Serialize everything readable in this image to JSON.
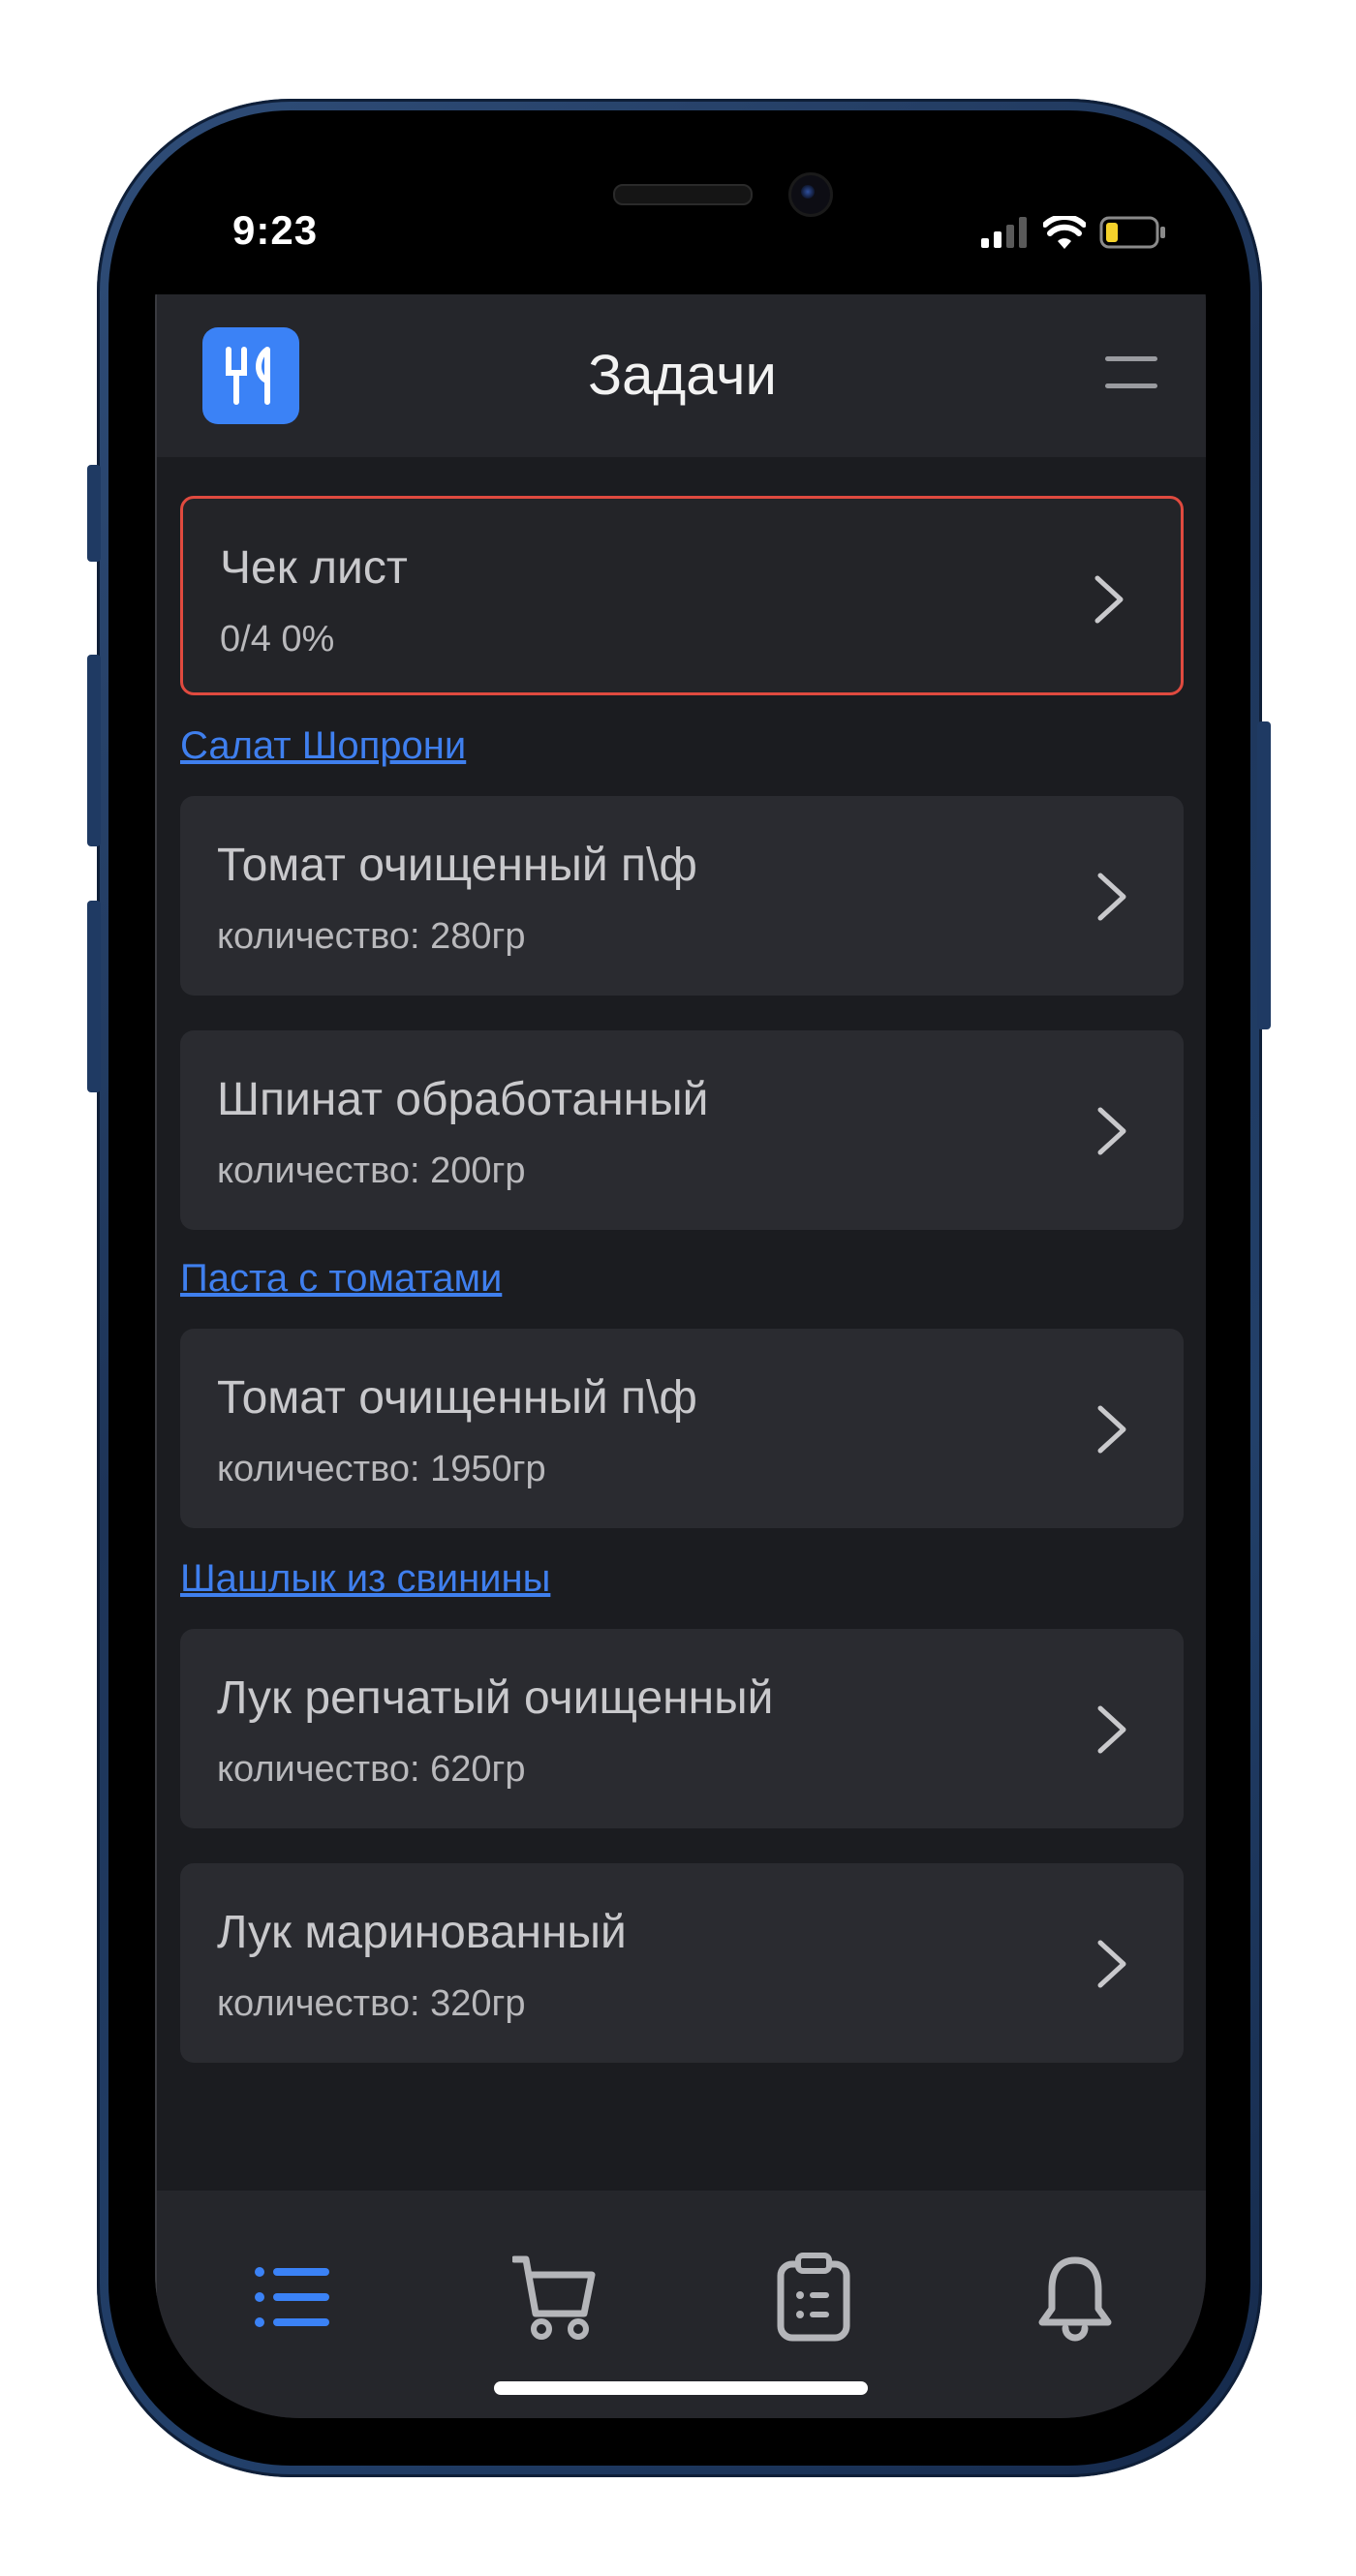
{
  "status_bar": {
    "time": "9:23"
  },
  "header": {
    "title": "Задачи"
  },
  "checklist": {
    "title": "Чек лист",
    "progress": "0/4 0%"
  },
  "sections": [
    {
      "title": "Салат Шопрони",
      "items": [
        {
          "name": "Томат очищенный п\\ф",
          "quantity": "количество: 280гр"
        },
        {
          "name": "Шпинат обработанный",
          "quantity": "количество: 200гр"
        }
      ]
    },
    {
      "title": "Паста с томатами",
      "items": [
        {
          "name": "Томат очищенный п\\ф",
          "quantity": "количество: 1950гр"
        }
      ]
    },
    {
      "title": "Шашлык из свинины",
      "items": [
        {
          "name": "Лук репчатый очищенный",
          "quantity": "количество: 620гр"
        },
        {
          "name": "Лук маринованный",
          "quantity": "количество: 320гр"
        }
      ]
    }
  ],
  "tabbar": {
    "tabs": [
      {
        "icon": "list-icon",
        "active": true
      },
      {
        "icon": "cart-icon",
        "active": false
      },
      {
        "icon": "clipboard-icon",
        "active": false
      },
      {
        "icon": "bell-icon",
        "active": false
      }
    ]
  },
  "colors": {
    "accent": "#3b82f6",
    "link": "#3f7fee",
    "highlight_border": "#e04a3f",
    "card_bg": "#2a2b30",
    "app_bg": "#1b1c20"
  }
}
